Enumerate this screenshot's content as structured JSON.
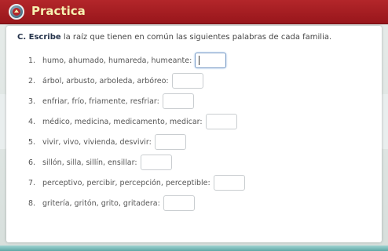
{
  "header": {
    "title": "Practica"
  },
  "instruction": {
    "prefix": "C. Escribe",
    "text": " la raíz que tienen en común las siguientes palabras de cada familia."
  },
  "items": [
    {
      "num": "1.",
      "words": "humo, ahumado, humareda, humeante:",
      "value": ""
    },
    {
      "num": "2.",
      "words": "árbol, arbusto, arboleda, arbóreo:",
      "value": ""
    },
    {
      "num": "3.",
      "words": "enfriar, frío, friamente, resfriar:",
      "value": ""
    },
    {
      "num": "4.",
      "words": "médico, medicina, medicamento, medicar:",
      "value": ""
    },
    {
      "num": "5.",
      "words": "vivir, vivo, vivienda, desvivir:",
      "value": ""
    },
    {
      "num": "6.",
      "words": "sillón, silla, sillín, ensillar:",
      "value": ""
    },
    {
      "num": "7.",
      "words": "perceptivo, percibir, percepción, perceptible:",
      "value": ""
    },
    {
      "num": "8.",
      "words": "gritería, gritón, grito, gritadera:",
      "value": ""
    }
  ]
}
